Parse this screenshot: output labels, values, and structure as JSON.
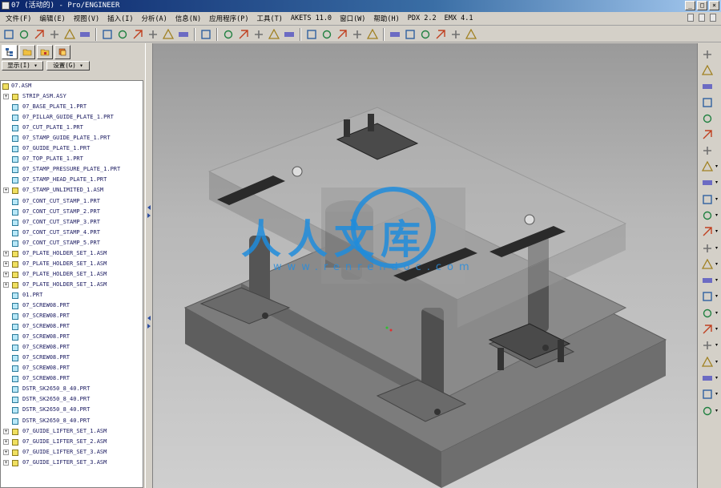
{
  "window": {
    "title": "07 (活动的) - Pro/ENGINEER"
  },
  "menubar": {
    "items": [
      "文件(F)",
      "编辑(E)",
      "视图(V)",
      "插入(I)",
      "分析(A)",
      "信息(N)",
      "应用程序(P)",
      "工具(T)",
      "AKETS 11.0",
      "窗口(W)",
      "帮助(H)",
      "PDX 2.2",
      "EMX 4.1"
    ]
  },
  "toolbar": {
    "icons": [
      "new-icon",
      "open-icon",
      "save-icon",
      "print-icon",
      "undo-icon",
      "redo-icon",
      "cut-icon",
      "copy-icon",
      "paste-icon",
      "regenerate-icon",
      "find-icon",
      "select-icon",
      "help-icon",
      "sketch-icon",
      "datum-plane-icon",
      "datum-axis-icon",
      "datum-point-icon",
      "csys-icon",
      "zoom-in-icon",
      "zoom-out-icon",
      "refit-icon",
      "orient-icon",
      "saved-views-icon",
      "wireframe-icon",
      "hidden-line-icon",
      "no-hidden-icon",
      "shading-icon",
      "spin-center-icon",
      "datum-display-icon"
    ]
  },
  "panel": {
    "dropdown_show": "显示(I) ▾",
    "dropdown_settings": "设置(G) ▾"
  },
  "model_tree": {
    "root": "07.ASM",
    "items": [
      {
        "label": "STRIP_ASM.ASY",
        "type": "asm",
        "expandable": true
      },
      {
        "label": "07_BASE_PLATE_1.PRT",
        "type": "prt",
        "expandable": false
      },
      {
        "label": "07_PILLAR_GUIDE_PLATE_1.PRT",
        "type": "prt",
        "expandable": false
      },
      {
        "label": "07_CUT_PLATE_1.PRT",
        "type": "prt",
        "expandable": false
      },
      {
        "label": "07_STAMP_GUIDE_PLATE_1.PRT",
        "type": "prt",
        "expandable": false
      },
      {
        "label": "07_GUIDE_PLATE_1.PRT",
        "type": "prt",
        "expandable": false
      },
      {
        "label": "07_TOP_PLATE_1.PRT",
        "type": "prt",
        "expandable": false
      },
      {
        "label": "07_STAMP_PRESSURE_PLATE_1.PRT",
        "type": "prt",
        "expandable": false
      },
      {
        "label": "07_STAMP_HEAD_PLATE_1.PRT",
        "type": "prt",
        "expandable": false
      },
      {
        "label": "07_STAMP_UNLIMITED_1.ASM",
        "type": "asm",
        "expandable": true
      },
      {
        "label": "07_CONT_CUT_STAMP_1.PRT",
        "type": "prt",
        "expandable": false
      },
      {
        "label": "07_CONT_CUT_STAMP_2.PRT",
        "type": "prt",
        "expandable": false
      },
      {
        "label": "07_CONT_CUT_STAMP_3.PRT",
        "type": "prt",
        "expandable": false
      },
      {
        "label": "07_CONT_CUT_STAMP_4.PRT",
        "type": "prt",
        "expandable": false
      },
      {
        "label": "07_CONT_CUT_STAMP_5.PRT",
        "type": "prt",
        "expandable": false
      },
      {
        "label": "07_PLATE_HOLDER_SET_1.ASM",
        "type": "asm",
        "expandable": true
      },
      {
        "label": "07_PLATE_HOLDER_SET_1.ASM",
        "type": "asm",
        "expandable": true
      },
      {
        "label": "07_PLATE_HOLDER_SET_1.ASM",
        "type": "asm",
        "expandable": true
      },
      {
        "label": "07_PLATE_HOLDER_SET_1.ASM",
        "type": "asm",
        "expandable": true
      },
      {
        "label": "01.PRT",
        "type": "prt",
        "expandable": false
      },
      {
        "label": "07_SCREW08.PRT",
        "type": "prt",
        "expandable": false
      },
      {
        "label": "07_SCREW08.PRT",
        "type": "prt",
        "expandable": false
      },
      {
        "label": "07_SCREW08.PRT",
        "type": "prt",
        "expandable": false
      },
      {
        "label": "07_SCREW08.PRT",
        "type": "prt",
        "expandable": false
      },
      {
        "label": "07_SCREW08.PRT",
        "type": "prt",
        "expandable": false
      },
      {
        "label": "07_SCREW08.PRT",
        "type": "prt",
        "expandable": false
      },
      {
        "label": "07_SCREW08.PRT",
        "type": "prt",
        "expandable": false
      },
      {
        "label": "07_SCREW08.PRT",
        "type": "prt",
        "expandable": false
      },
      {
        "label": "DSTR_SK2650_8_40.PRT",
        "type": "prt",
        "expandable": false
      },
      {
        "label": "DSTR_SK2650_8_40.PRT",
        "type": "prt",
        "expandable": false
      },
      {
        "label": "DSTR_SK2650_8_40.PRT",
        "type": "prt",
        "expandable": false
      },
      {
        "label": "DSTR_SK2650_8_40.PRT",
        "type": "prt",
        "expandable": false
      },
      {
        "label": "07_GUIDE_LIFTER_SET_1.ASM",
        "type": "asm",
        "expandable": true
      },
      {
        "label": "07_GUIDE_LIFTER_SET_2.ASM",
        "type": "asm",
        "expandable": true
      },
      {
        "label": "07_GUIDE_LIFTER_SET_3.ASM",
        "type": "asm",
        "expandable": true
      },
      {
        "label": "07_GUIDE_LIFTER_SET_3.ASM",
        "type": "asm",
        "expandable": true
      }
    ]
  },
  "right_toolbar": {
    "icons": [
      "pan-icon",
      "dimension-icon",
      "plane-icon",
      "axis-icon",
      "curve-icon",
      "point-icon",
      "csys-icon",
      "new-icon",
      "component-icon",
      "mold-icon",
      "feature-icon",
      "tool-icon",
      "pen-icon",
      "check-icon",
      "layer-icon",
      "grid-icon",
      "view-icon",
      "swap-icon",
      "green-icon",
      "table-icon",
      "insert-icon",
      "flag-icon",
      "bottom-icon"
    ]
  },
  "watermark": {
    "text": "人人文库",
    "url": "www.renrendoc.com"
  },
  "colors": {
    "accent": "#0a246a",
    "tree_text": "#1a1a60",
    "viewport_bg": "#b8b8b8",
    "watermark": "#1e8cdc"
  }
}
